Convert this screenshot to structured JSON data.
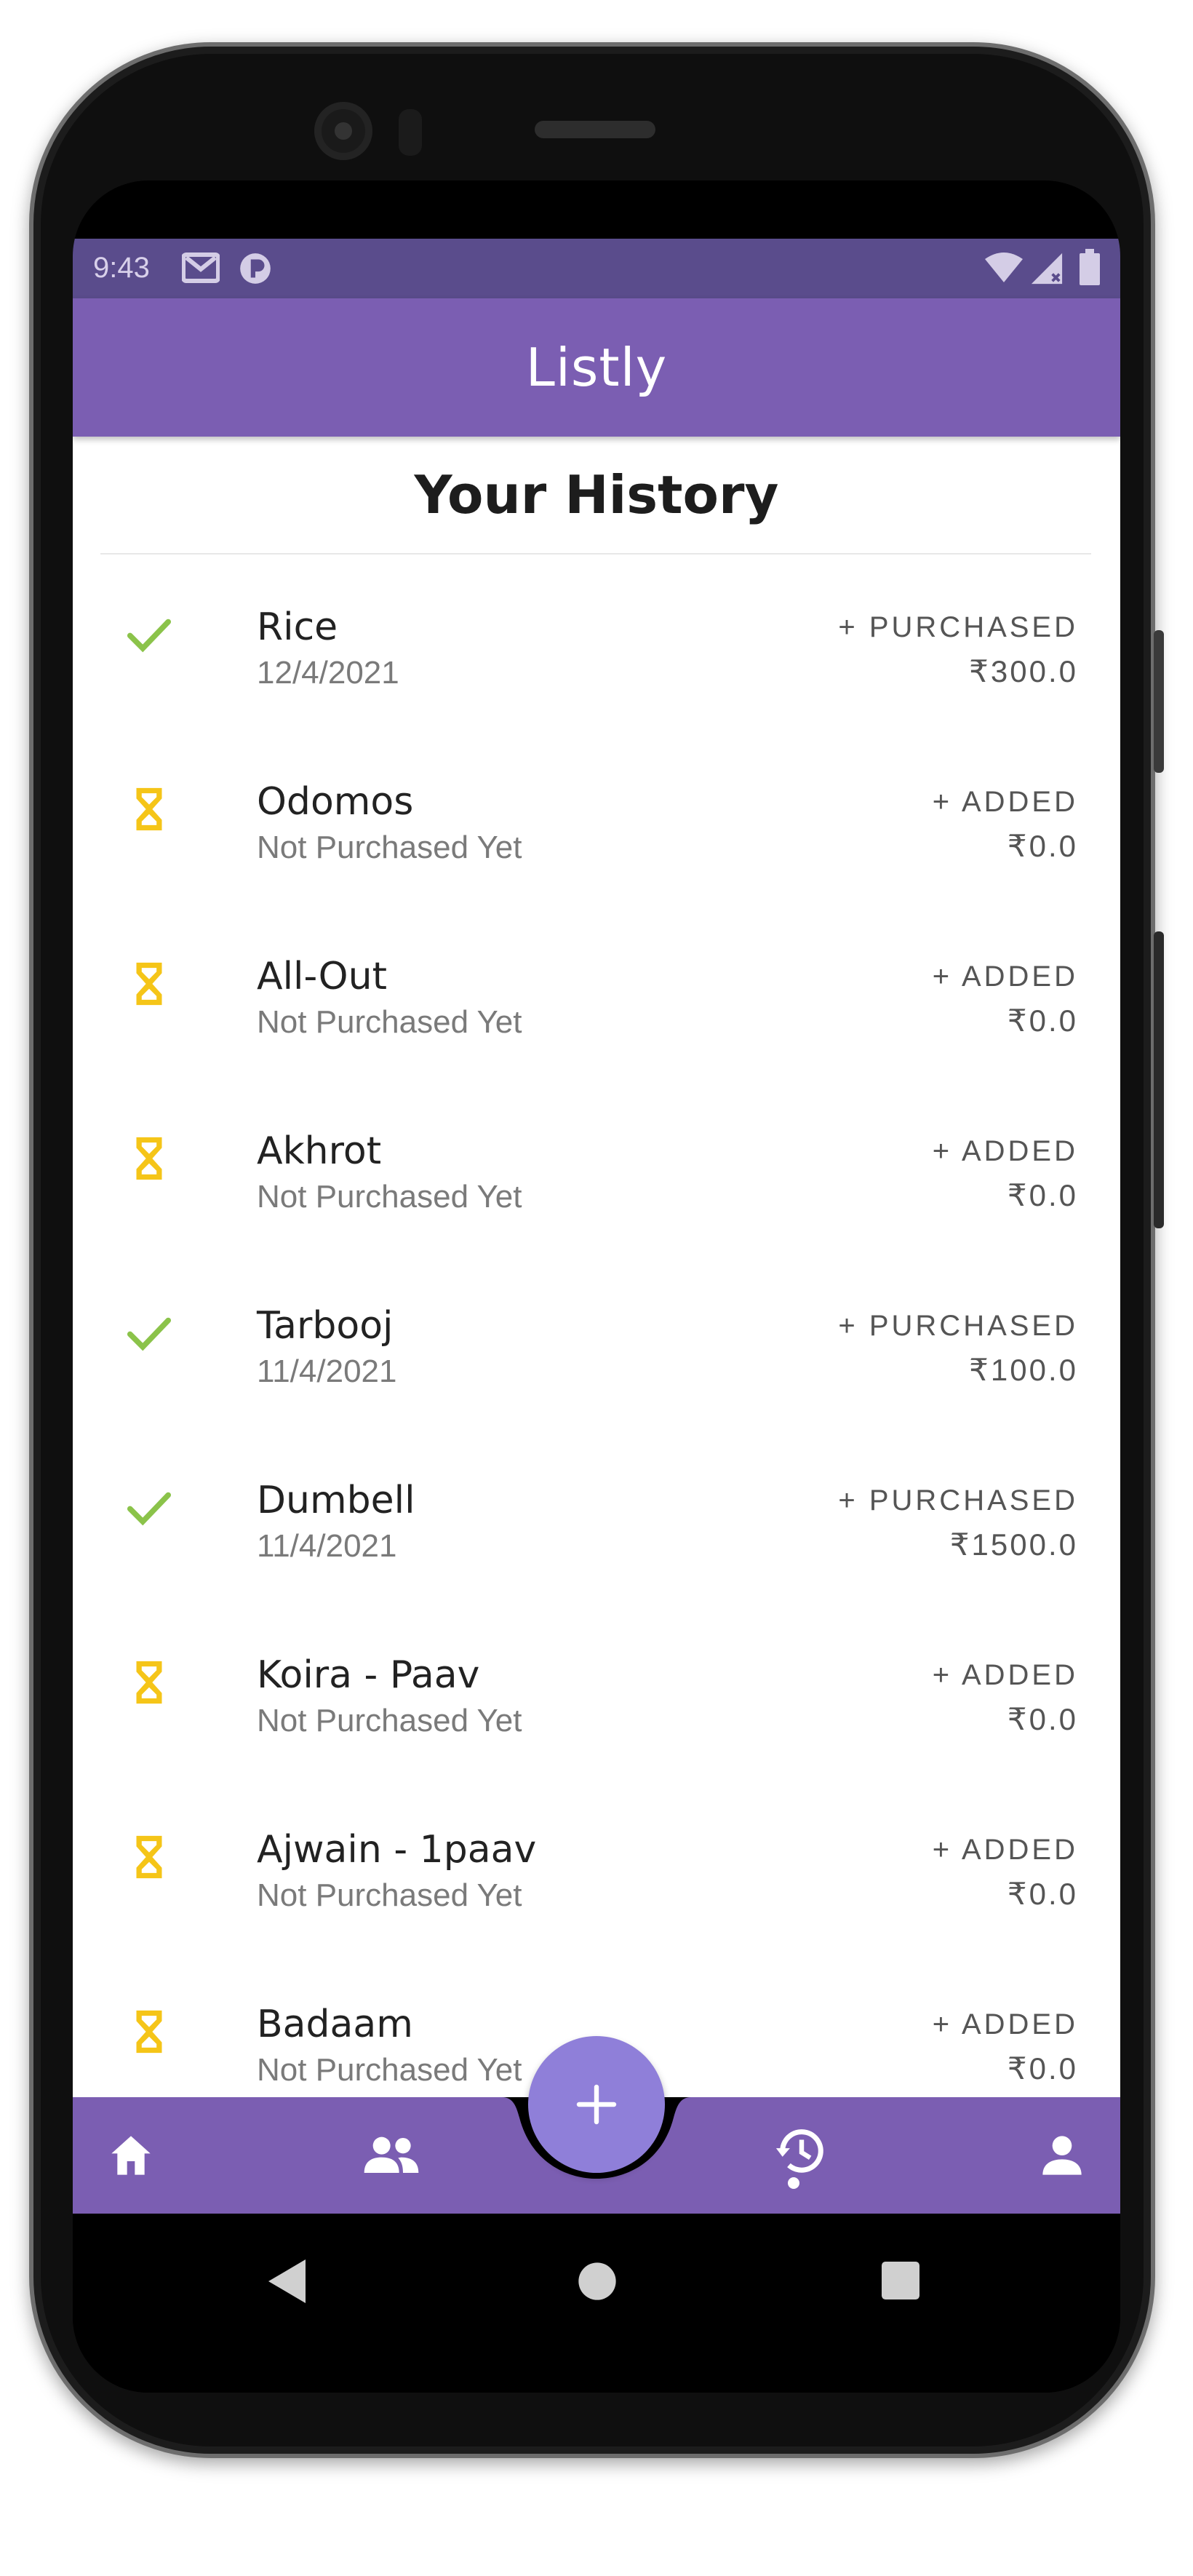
{
  "status_bar": {
    "time": "9:43",
    "icons": [
      "gmail-icon",
      "app-icon",
      "wifi-icon",
      "signal-icon",
      "battery-icon"
    ]
  },
  "app_bar": {
    "title": "Listly"
  },
  "page": {
    "title": "Your History"
  },
  "colors": {
    "app_bar": "#7b5eb2",
    "status_bar": "#5a4c8c",
    "fab": "#8f7fd9",
    "purchased_check": "#8bc34a",
    "pending_hourglass": "#f5c518"
  },
  "history": [
    {
      "status": "purchased",
      "name": "Rice",
      "sub": "12/4/2021",
      "action": "+ PURCHASED",
      "price": "₹300.0"
    },
    {
      "status": "pending",
      "name": "Odomos",
      "sub": "Not Purchased Yet",
      "action": "+ ADDED",
      "price": "₹0.0"
    },
    {
      "status": "pending",
      "name": "All-Out",
      "sub": "Not Purchased Yet",
      "action": "+ ADDED",
      "price": "₹0.0"
    },
    {
      "status": "pending",
      "name": "Akhrot",
      "sub": "Not Purchased Yet",
      "action": "+ ADDED",
      "price": "₹0.0"
    },
    {
      "status": "purchased",
      "name": "Tarbooj",
      "sub": "11/4/2021",
      "action": "+ PURCHASED",
      "price": "₹100.0"
    },
    {
      "status": "purchased",
      "name": "Dumbell",
      "sub": "11/4/2021",
      "action": "+ PURCHASED",
      "price": "₹1500.0"
    },
    {
      "status": "pending",
      "name": "Koira - Paav",
      "sub": "Not Purchased Yet",
      "action": "+ ADDED",
      "price": "₹0.0"
    },
    {
      "status": "pending",
      "name": "Ajwain - 1paav",
      "sub": "Not Purchased Yet",
      "action": "+ ADDED",
      "price": "₹0.0"
    },
    {
      "status": "pending",
      "name": "Badaam",
      "sub": "Not Purchased Yet",
      "action": "+ ADDED",
      "price": "₹0.0"
    }
  ],
  "bottom_nav": {
    "items": [
      "home-icon",
      "group-icon",
      "history-icon",
      "profile-icon"
    ],
    "active": "history-icon",
    "fab_icon": "add-icon"
  },
  "system_nav": [
    "back-icon",
    "home-circle-icon",
    "recents-icon"
  ]
}
